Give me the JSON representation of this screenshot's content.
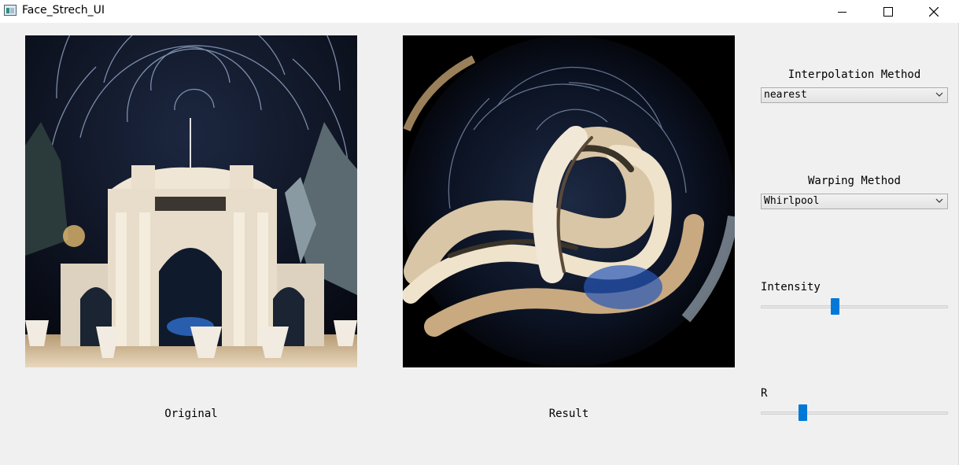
{
  "window": {
    "title": "Face_Strech_UI",
    "icon": "app-window-icon",
    "controls": [
      "minimize-icon",
      "maximize-icon",
      "close-icon"
    ]
  },
  "panels": {
    "original_caption": "Original",
    "result_caption": "Result"
  },
  "controls": {
    "interpolation_label": "Interpolation Method",
    "interpolation_value": "nearest",
    "warping_label": "Warping Method",
    "warping_value": "Whirlpool",
    "intensity_label": "Intensity",
    "intensity_value_fraction": 0.39,
    "r_label": "R",
    "r_value_fraction": 0.21
  },
  "colors": {
    "slider_thumb": "#0078d7",
    "window_bg": "#f0f0f0"
  }
}
